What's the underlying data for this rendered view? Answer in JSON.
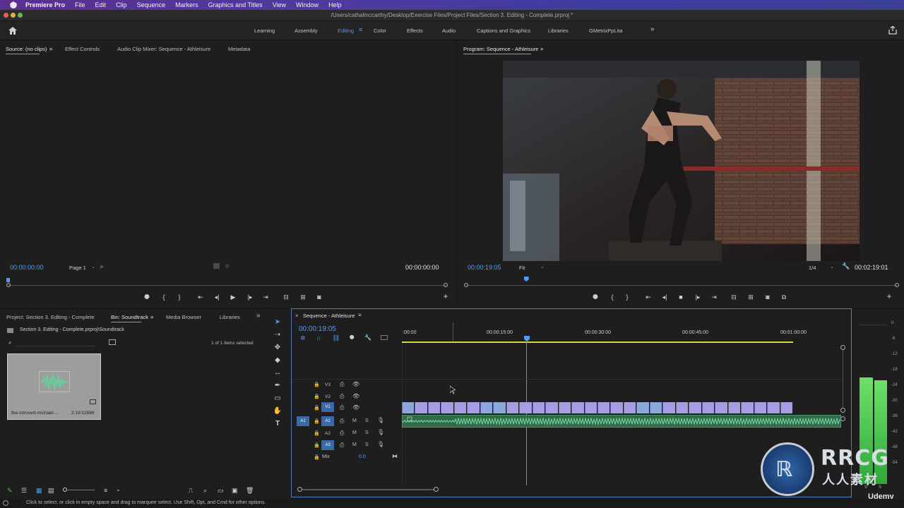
{
  "menubar": {
    "app": "Premiere Pro",
    "items": [
      "File",
      "Edit",
      "Clip",
      "Sequence",
      "Markers",
      "Graphics and Titles",
      "View",
      "Window",
      "Help"
    ]
  },
  "titlebar": {
    "path": "/Users/cathalmccarthy/Desktop/Exercise Files/Project Files/Section 3. Editing - Complete.prproj *"
  },
  "workspaces": {
    "items": [
      "Learning",
      "Assembly",
      "Editing",
      "Color",
      "Effects",
      "Audio",
      "Captions and Graphics",
      "Libraries",
      "GMetrixPpLita"
    ],
    "active": "Editing",
    "more": "»"
  },
  "source": {
    "tabs": [
      "Source: (no clips)",
      "Effect Controls",
      "Audio Clip Mixer: Sequence - Athleisure",
      "Metadata"
    ],
    "timecode_left": "00:00:00:00",
    "page": "Page 1",
    "timecode_right": "00:00:00:00"
  },
  "program": {
    "title": "Program: Sequence - Athleisure",
    "timecode_left": "00:00:19:05",
    "zoom": "Fit",
    "resolution": "1/4",
    "timecode_right": "00:02:19:01",
    "playhead_fraction": 0.14
  },
  "project": {
    "tabs": [
      "Project: Section 3. Editing - Complete",
      "Bin: Soundtrack",
      "Media Browser",
      "Libraries"
    ],
    "more": "»",
    "path": "Section 3. Editing - Complete.prproj\\Soundtrack",
    "items_selected": "1 of 1 items selected",
    "clip": {
      "name": "the-introvert-michael-...",
      "duration": "2:19:02688"
    }
  },
  "timeline": {
    "title": "Sequence - Athleisure",
    "timecode": "00:00:19:05",
    "ruler_labels": [
      ":00:00",
      "00:00:15:00",
      "00:00:30:00",
      "00:00:45:00",
      "00:01:00:00"
    ],
    "video_tracks": [
      "V3",
      "V2",
      "V1"
    ],
    "audio_tracks": [
      "A1",
      "A2",
      "A3"
    ],
    "source_patch": {
      "video": "V1",
      "audio": "A1"
    },
    "track_buttons": {
      "mute": "M",
      "solo": "S"
    },
    "mix_label": "Mix",
    "mix_value": "0.0"
  },
  "meters": {
    "scale": [
      "0",
      "-6",
      "-12",
      "-18",
      "-24",
      "-30",
      "-36",
      "-42",
      "-48",
      "-54"
    ],
    "solo": [
      "S",
      "S"
    ],
    "level_left_db": -21,
    "level_right_db": -22
  },
  "status": {
    "text": "Click to select, or click in empty space and drag to marquee select. Use Shift, Opt, and Cmd for other options."
  },
  "watermark": {
    "brand": "RRCG",
    "sub": "人人素材",
    "udemy": "Udemy"
  },
  "colors": {
    "accent": "#4f9cf5",
    "video_clip": "#a79ce6",
    "audio_clip": "#5fbf85",
    "track_patch": "#3a6aa5"
  }
}
